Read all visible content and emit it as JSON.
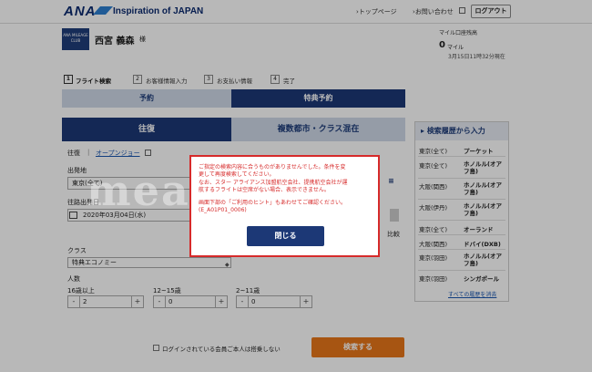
{
  "header": {
    "logo": "ANA",
    "tagline": "Inspiration of JAPAN",
    "nav_top": "トップページ",
    "nav_contact": "お問い合わせ",
    "logout": "ログアウト"
  },
  "member": {
    "club_logo": "ANA MILEAGE CLUB",
    "name": "西宮 義森",
    "suffix": "様",
    "miles_label": "マイル口座残高",
    "miles_value": "0",
    "miles_unit": "マイル",
    "miles_date": "3月15日11時32分現在"
  },
  "steps": [
    {
      "num": "1",
      "label": "フライト検索"
    },
    {
      "num": "2",
      "label": "お客様情報入力"
    },
    {
      "num": "3",
      "label": "お支払い情報"
    },
    {
      "num": "4",
      "label": "完了"
    }
  ],
  "tabs": {
    "reservation": "予約",
    "award": "特典予約"
  },
  "trip_tabs": {
    "round": "往復",
    "multi": "複数都市・クラス混在"
  },
  "form": {
    "trip_type": "往復",
    "open_jaw": "オープンジョー",
    "departure_label": "出発地",
    "departure_value": "東京(全て)",
    "date_label": "往路出発日",
    "date_value": "2020年03月04日(水)",
    "compare_partial": "比較",
    "class_label": "クラス",
    "class_value": "特典エコノミー",
    "pax_label": "人数",
    "adult_label": "16歳以上",
    "adult_value": "2",
    "youth_label": "12~15歳",
    "youth_value": "0",
    "child_label": "2~11歳",
    "child_value": "0",
    "minus": "-",
    "plus": "+",
    "not_boarding": "ログインされている会員ご本人は搭乗しない",
    "search_button": "検索する"
  },
  "history": {
    "title": "検索履歴から入力",
    "items": [
      {
        "from": "東京(全て)",
        "to": "プーケット"
      },
      {
        "from": "東京(全て)",
        "to": "ホノルル(オアフ島)"
      },
      {
        "from": "大阪(関西)",
        "to": "ホノルル(オアフ島)"
      },
      {
        "from": "大阪(伊丹)",
        "to": "ホノルル(オアフ島)"
      },
      {
        "from": "東京(全て)",
        "to": "オーランド"
      },
      {
        "from": "大阪(関西)",
        "to": "ドバイ(DXB)"
      },
      {
        "from": "東京(羽田)",
        "to": "ホノルル(オアフ島)"
      },
      {
        "from": "東京(羽田)",
        "to": "シンガポール"
      }
    ],
    "view_all": "すべての履歴を消去"
  },
  "modal": {
    "line1": "ご指定の検索内容に合うものがありませんでした。条件を変",
    "line2": "更して再度検索してください。",
    "line3": "なお、スター アライアンス加盟航空会社、提携航空会社が運",
    "line4": "航するフライトは空席がない場合、表示できません。",
    "line5": "画面下部の「ご利用のヒント」もあわせてご確認ください。",
    "line6": "(E_A01P01_0006)",
    "close": "閉じる"
  },
  "watermark": "measure"
}
